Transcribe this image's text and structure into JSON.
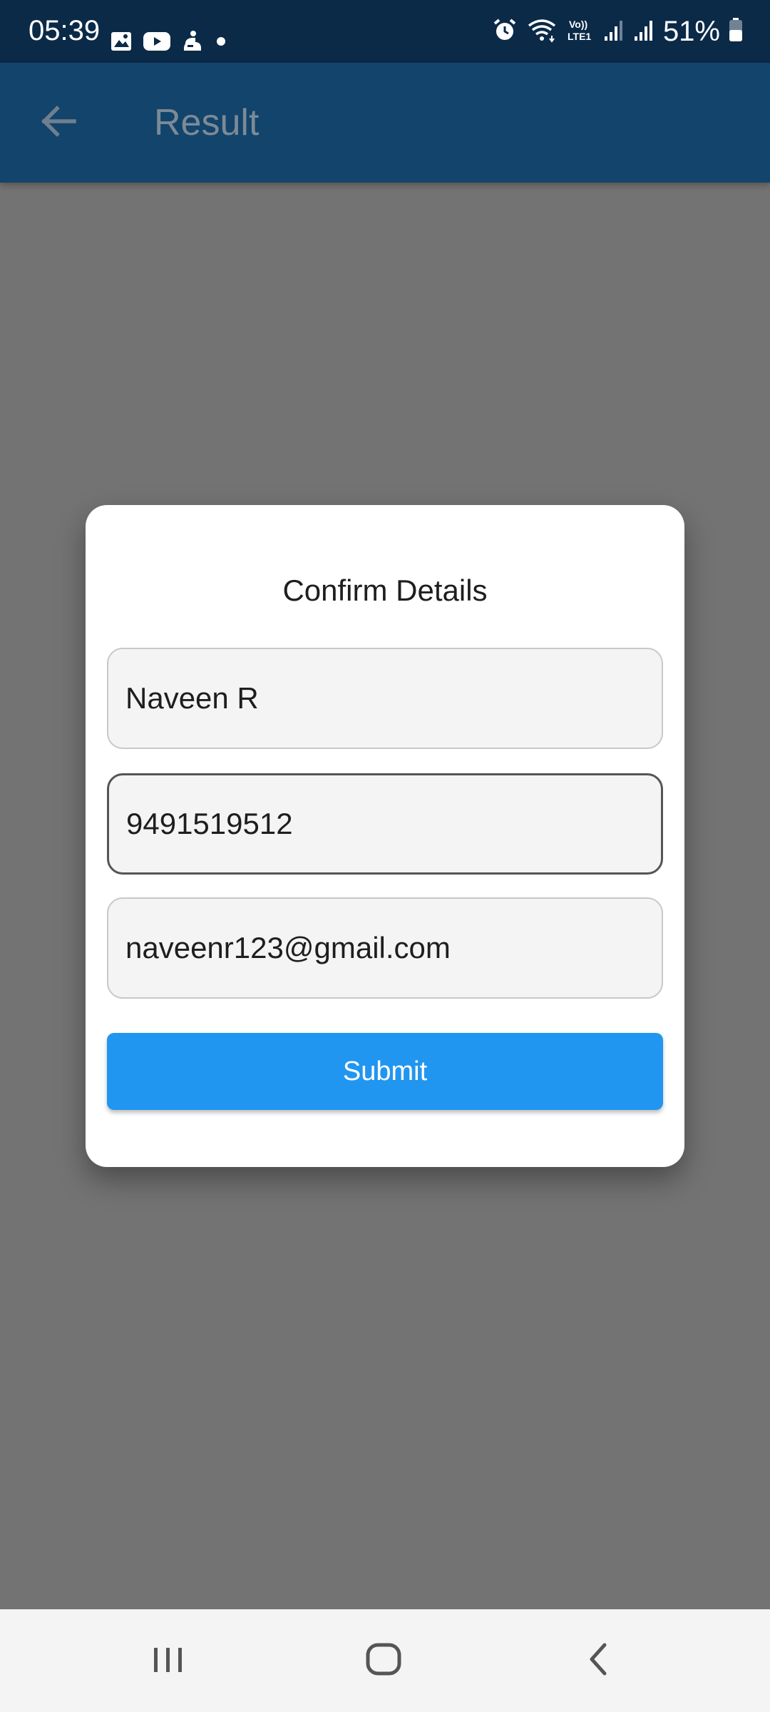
{
  "status_bar": {
    "time": "05:39",
    "battery_percent": "51%",
    "left_icons": [
      "gallery-icon",
      "youtube-icon",
      "app-notification-icon",
      "dot-icon"
    ],
    "right_icons": [
      "alarm-icon",
      "wifi-icon",
      "volte-icon",
      "signal-icon",
      "signal-icon",
      "battery-icon"
    ],
    "volte_label": "Vo))\nLTE1"
  },
  "app_bar": {
    "title": "Result",
    "back_icon": "arrow-back-icon"
  },
  "dialog": {
    "title": "Confirm Details",
    "fields": {
      "name": "Naveen R",
      "phone": "9491519512",
      "email": "naveenr123@gmail.com"
    },
    "submit_label": "Submit"
  },
  "nav_bar": {
    "icons": [
      "recents-icon",
      "home-icon",
      "back-icon"
    ]
  },
  "colors": {
    "status_bar": "#0b2a48",
    "app_bar": "#12446c",
    "scrim": "#737373",
    "accent": "#2196f0"
  }
}
